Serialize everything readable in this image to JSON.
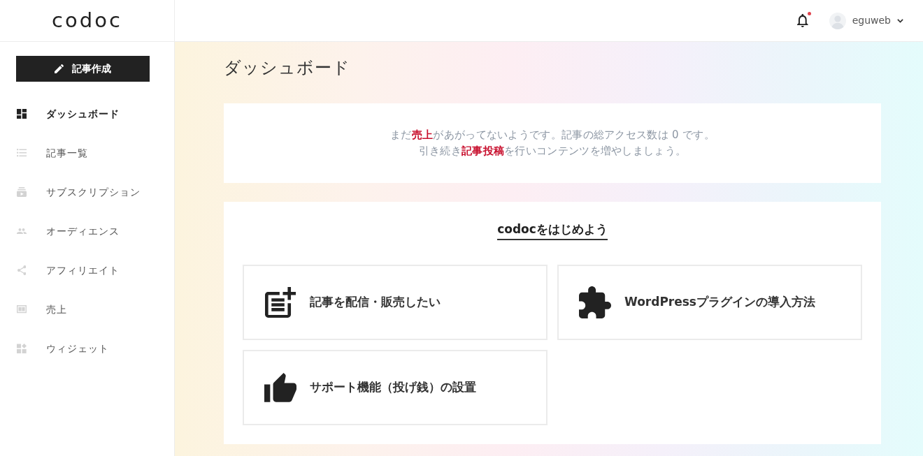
{
  "header": {
    "logo": "codoc",
    "notifications": {
      "unread": true
    },
    "user": {
      "name": "eguweb"
    }
  },
  "sidebar": {
    "compose_button": {
      "label": "記事作成"
    },
    "items": [
      {
        "label": "ダッシュボード",
        "selected": true
      },
      {
        "label": "記事一覧",
        "selected": false
      },
      {
        "label": "サブスクリプション",
        "selected": false
      },
      {
        "label": "オーディエンス",
        "selected": false
      },
      {
        "label": "アフィリエイト",
        "selected": false
      },
      {
        "label": "売上",
        "selected": false
      },
      {
        "label": "ウィジェット",
        "selected": false
      }
    ]
  },
  "page": {
    "title": "ダッシュボード"
  },
  "notice": {
    "lines": [
      "まだ**売上**があがってないようです。記事の総アクセス数は 0 です。",
      "引き続き**記事投稿**を行いコンテンツを増やしましょう。"
    ]
  },
  "getting_started": {
    "title": "codocをはじめよう",
    "tiles": [
      {
        "label": "記事を配信・販売したい"
      },
      {
        "label": "WordPressプラグインの導入方法"
      },
      {
        "label": "サポート機能（投げ銭）の設置"
      }
    ]
  }
}
